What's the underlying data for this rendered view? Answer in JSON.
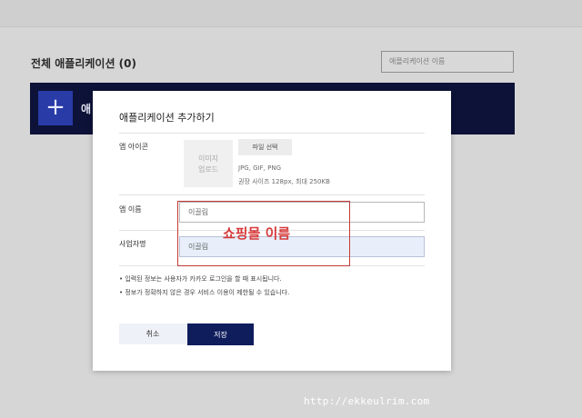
{
  "background": {
    "page_title": "전체 애플리케이션 (0)",
    "search_placeholder": "애플리케이션 이름",
    "add_icon": "+",
    "banner_text": "애"
  },
  "modal": {
    "title": "애플리케이션 추가하기",
    "app_icon_label": "앱 아이콘",
    "icon_placeholder_line1": "이미지",
    "icon_placeholder_line2": "업로드",
    "file_button": "파일 선택",
    "file_hint_formats": "JPG, GIF, PNG",
    "file_hint_size": "권장 사이즈 128px, 최대 250KB",
    "app_name_label": "앱 이름",
    "app_name_value": "이끌림",
    "company_label": "사업자명",
    "company_value": "이끌림",
    "note1": "• 입력된 정보는 사용자가 카카오 로그인을 할 때 표시됩니다.",
    "note2": "• 정보가 정확하지 않은 경우 서비스 이용이 제한될 수 있습니다.",
    "cancel_label": "취소",
    "save_label": "저장"
  },
  "annotation": {
    "text": "쇼핑몰 이름",
    "color": "#d73a3a"
  },
  "watermark": "http://ekkeulrim.com"
}
